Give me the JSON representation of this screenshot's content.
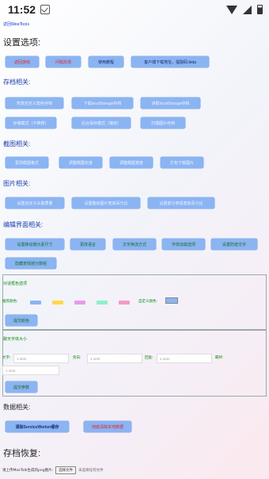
{
  "status_bar": {
    "time": "11:52"
  },
  "back_link": "返回WeeTools",
  "settings": {
    "title": "设置选项:",
    "buttons": [
      "返回游戏",
      "问题反馈",
      "使用教程",
      "客户端下载地址，提取码:bida"
    ]
  },
  "storage": {
    "title": "存档相关:",
    "buttons": [
      "恢复自定义角色存档",
      "下载localStorage存档",
      "读取localStorage存档",
      "存储模式（不推荐）",
      "后台保存模式（慎用）",
      "扫描图片存档"
    ]
  },
  "screenshot": {
    "title": "截图相关:",
    "buttons": [
      "更改截图格式",
      "调整截图长度",
      "调整截图宽度",
      "打包下载图片"
    ]
  },
  "image": {
    "title": "图片相关:",
    "buttons": [
      "设置自定义头像质量",
      "设置整体图片宽高百分比",
      "设置部分表情宽高百分比"
    ]
  },
  "editor": {
    "title": "编辑界面相关:",
    "buttons": [
      "设置移动端元素尺寸",
      "更改语言",
      "文字换流方式",
      "字体加载选项",
      "设置防遮文字",
      "隐藏表情部分数组"
    ]
  },
  "border_color": {
    "title": "对话框色选项",
    "recommend_label": "推荐颜色:",
    "swatches": [
      "#8bb4f2",
      "#ffd84a",
      "#e79bf0",
      "#8ef0c8",
      "#f59ac8"
    ],
    "custom_label": "自定义颜色:",
    "custom_value": "#8bb4f2",
    "submit": "提交颜色"
  },
  "font_size": {
    "title": "聊天字体大小",
    "fields": [
      {
        "label": "文字:",
        "placeholder": "1.2em"
      },
      {
        "label": "旁白:",
        "placeholder": "1.1em"
      },
      {
        "label": "回复:",
        "placeholder": "1.1em"
      },
      {
        "label": "羁绊:",
        "placeholder": ""
      },
      {
        "label": "",
        "placeholder": "1.1em"
      }
    ],
    "submit": "提交参数"
  },
  "data": {
    "title": "数据相关:",
    "buttons": [
      "清除ServiceWorker缓存",
      "彻底清除本地数据"
    ]
  },
  "restore": {
    "title": "存档恢复:",
    "upload_label": "请上传MoeTalk生成的png图片:",
    "file_button": "选择文件",
    "file_status": "未选择任何文件"
  }
}
